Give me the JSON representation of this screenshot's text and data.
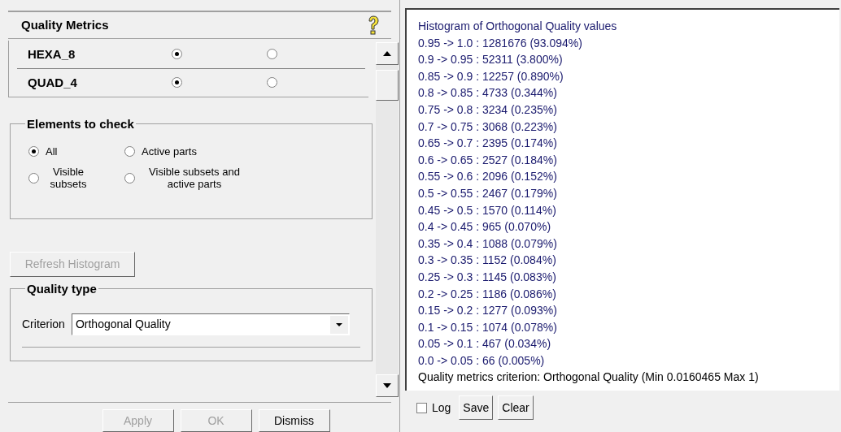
{
  "quality_metrics": {
    "title": "Quality Metrics",
    "element_types": [
      {
        "label": "HEXA_8",
        "options": [
          {
            "selected": true
          },
          {
            "selected": false
          }
        ]
      },
      {
        "label": "QUAD_4",
        "options": [
          {
            "selected": true
          },
          {
            "selected": false
          }
        ]
      }
    ]
  },
  "elements_to_check": {
    "title": "Elements to check",
    "options": [
      {
        "label": "All",
        "selected": true
      },
      {
        "label": "Active parts",
        "selected": false
      },
      {
        "label": "Visible subsets",
        "selected": false
      },
      {
        "label": "Visible subsets and active parts",
        "selected": false
      }
    ]
  },
  "refresh_button": {
    "label": "Refresh Histogram",
    "disabled": true
  },
  "quality_type": {
    "title": "Quality type",
    "criterion_label": "Criterion",
    "criterion_value": "Orthogonal Quality"
  },
  "dialog_buttons": [
    {
      "label": "Apply",
      "disabled": true
    },
    {
      "label": "OK",
      "disabled": true
    },
    {
      "label": "Dismiss",
      "disabled": false
    }
  ],
  "histogram_output": {
    "lines": [
      "Histogram of Orthogonal Quality values",
      "0.95 -> 1.0 : 1281676 (93.094%)",
      "0.9 -> 0.95 : 52311 (3.800%)",
      "0.85 -> 0.9 : 12257 (0.890%)",
      "0.8 -> 0.85 : 4733 (0.344%)",
      "0.75 -> 0.8 : 3234 (0.235%)",
      "0.7 -> 0.75 : 3068 (0.223%)",
      "0.65 -> 0.7 : 2395 (0.174%)",
      "0.6 -> 0.65 : 2527 (0.184%)",
      "0.55 -> 0.6 : 2096 (0.152%)",
      "0.5 -> 0.55 : 2467 (0.179%)",
      "0.45 -> 0.5 : 1570 (0.114%)",
      "0.4 -> 0.45 : 965 (0.070%)",
      "0.35 -> 0.4 : 1088 (0.079%)",
      "0.3 -> 0.35 : 1152 (0.084%)",
      "0.25 -> 0.3 : 1145 (0.083%)",
      "0.2 -> 0.25 : 1186 (0.086%)",
      "0.15 -> 0.2 : 1277 (0.093%)",
      "0.1 -> 0.15 : 1074 (0.078%)",
      "0.05 -> 0.1 : 467 (0.034%)",
      "0.0 -> 0.05 : 66 (0.005%)"
    ],
    "summary": "Quality metrics criterion: Orthogonal Quality (Min 0.0160465 Max 1)"
  },
  "log_checkbox": {
    "label": "Log",
    "checked": false
  },
  "output_buttons": [
    "Save",
    "Clear"
  ]
}
